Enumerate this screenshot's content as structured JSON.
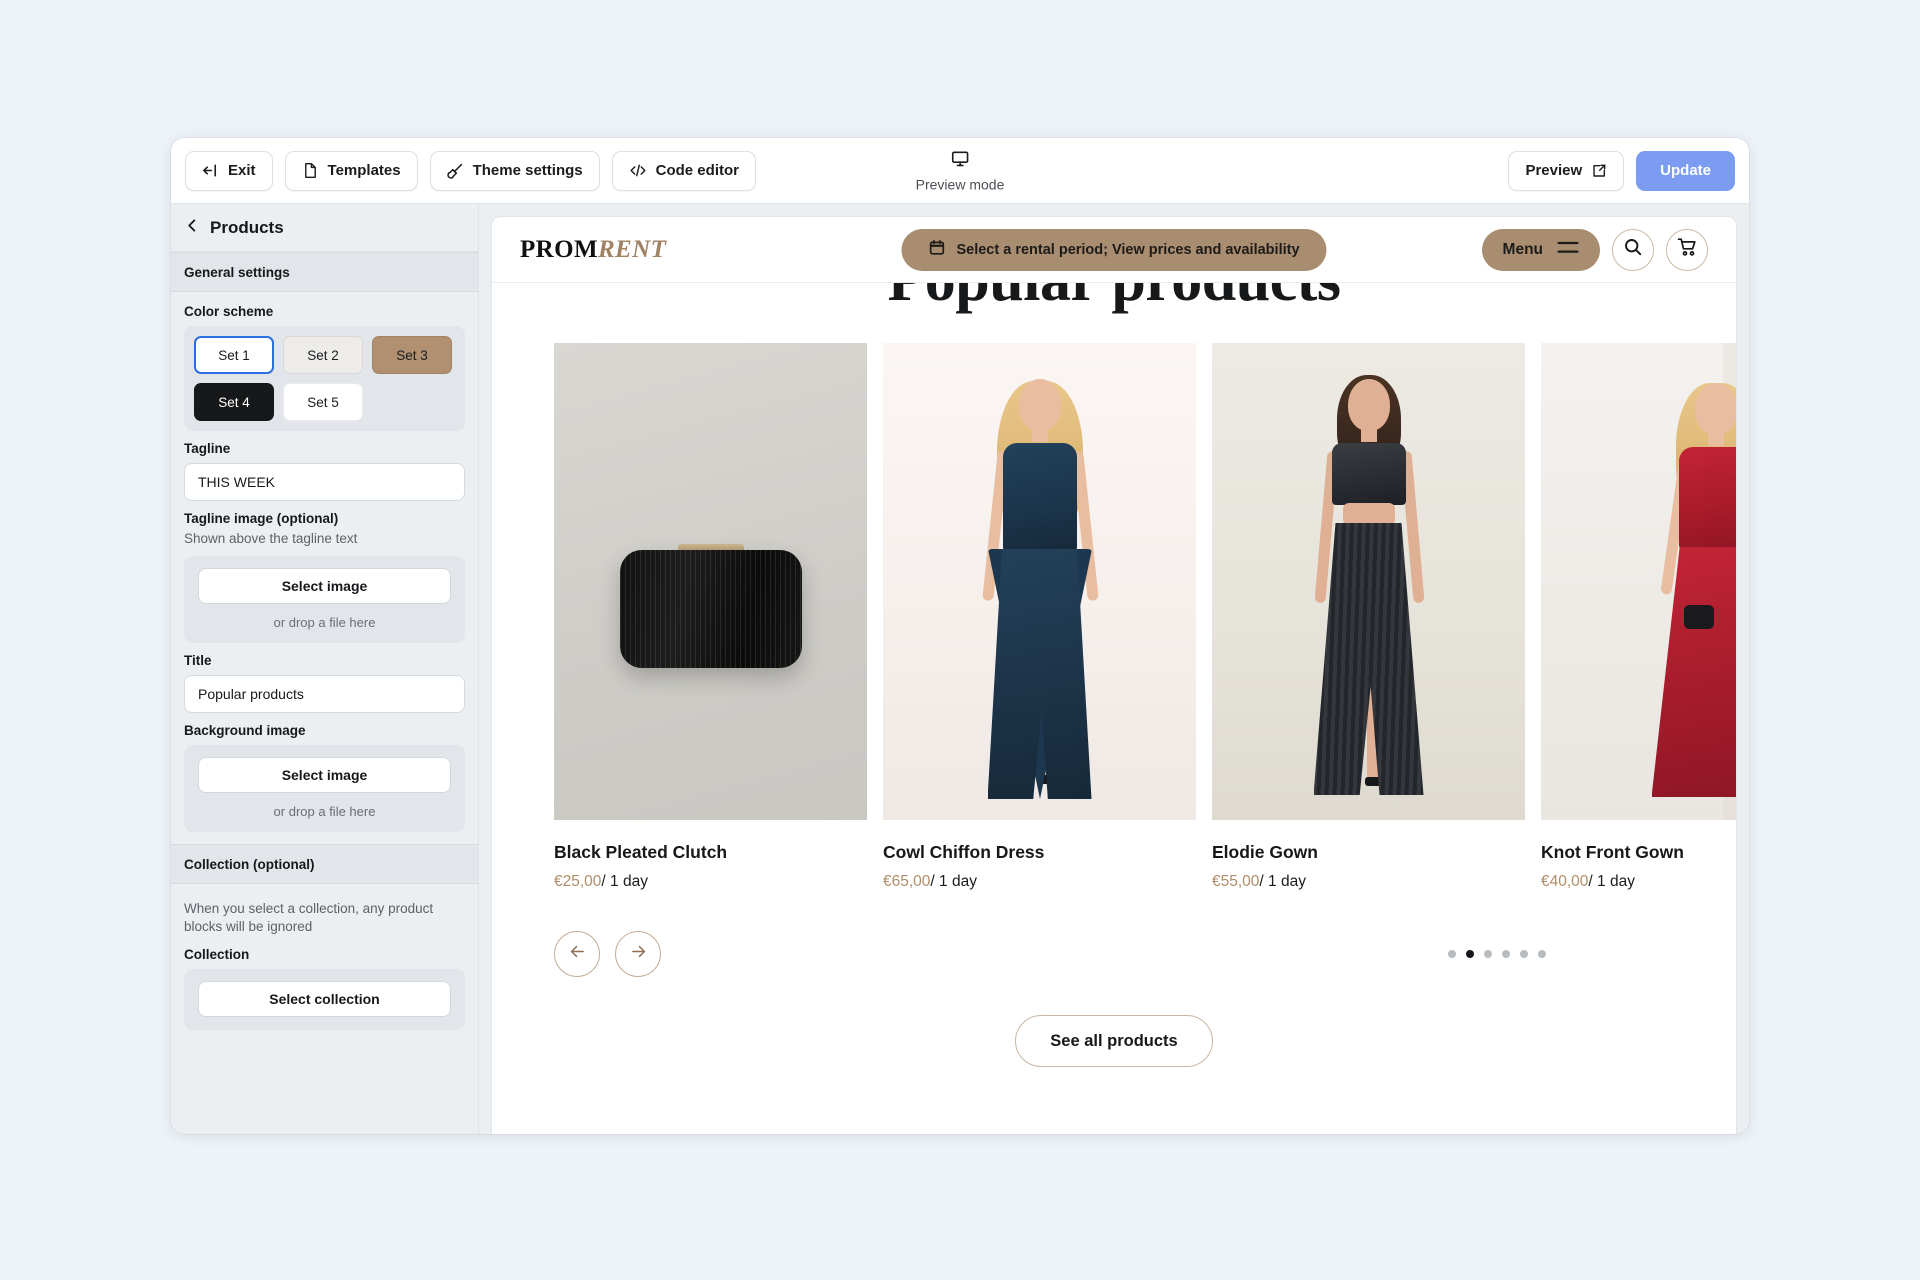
{
  "topbar": {
    "exit_label": "Exit",
    "templates_label": "Templates",
    "theme_settings_label": "Theme settings",
    "code_editor_label": "Code editor",
    "preview_mode_label": "Preview mode",
    "preview_label": "Preview",
    "update_label": "Update"
  },
  "sidebar": {
    "back_title": "Products",
    "sections": [
      {
        "heading": "General settings"
      },
      {
        "heading": "Collection (optional)"
      }
    ],
    "color_scheme": {
      "label": "Color scheme",
      "options": [
        {
          "label": "Set 1",
          "bg": "#ffffff",
          "fg": "#1a1c1e",
          "selected": true
        },
        {
          "label": "Set 2",
          "bg": "#eeece9",
          "fg": "#1a1c1e",
          "selected": false
        },
        {
          "label": "Set 3",
          "bg": "#b09070",
          "fg": "#1a1c1e",
          "selected": false
        },
        {
          "label": "Set 4",
          "bg": "#17181a",
          "fg": "#ffffff",
          "selected": false
        },
        {
          "label": "Set 5",
          "bg": "#ffffff",
          "fg": "#1a1c1e",
          "selected": false
        }
      ]
    },
    "tagline": {
      "label": "Tagline",
      "value": "THIS WEEK"
    },
    "tagline_image": {
      "label": "Tagline image (optional)",
      "help": "Shown above the tagline text",
      "button": "Select image",
      "drop_hint": "or drop a file here"
    },
    "title": {
      "label": "Title",
      "value": "Popular products"
    },
    "background_image": {
      "label": "Background image",
      "button": "Select image",
      "drop_hint": "or drop a file here"
    },
    "collection": {
      "help": "When you select a collection, any product blocks will be ignored",
      "label": "Collection",
      "button": "Select collection"
    }
  },
  "store": {
    "logo_primary": "PROM",
    "logo_secondary": "RENT",
    "rental_pill": "Select a rental period; View prices and availability",
    "menu_label": "Menu",
    "section_title": "Popular products",
    "see_all_label": "See all products",
    "carousel": {
      "dots_total": 6,
      "active_dot": 2,
      "prev_icon": "arrow-left-icon",
      "next_icon": "arrow-right-icon"
    },
    "products": [
      {
        "name": "Black Pleated Clutch",
        "price": "€25,00",
        "per": "/ 1 day"
      },
      {
        "name": "Cowl Chiffon Dress",
        "price": "€65,00",
        "per": "/ 1 day"
      },
      {
        "name": "Elodie Gown",
        "price": "€55,00",
        "per": "/ 1 day"
      },
      {
        "name": "Knot Front Gown",
        "price": "€40,00",
        "per": "/ 1 day"
      }
    ]
  },
  "colors": {
    "brand_tan": "#a98d70",
    "price_tan": "#b08d68",
    "update_blue": "#7b9cf0",
    "selected_blue": "#2b6fe3",
    "canvas": "#eef3f8"
  }
}
